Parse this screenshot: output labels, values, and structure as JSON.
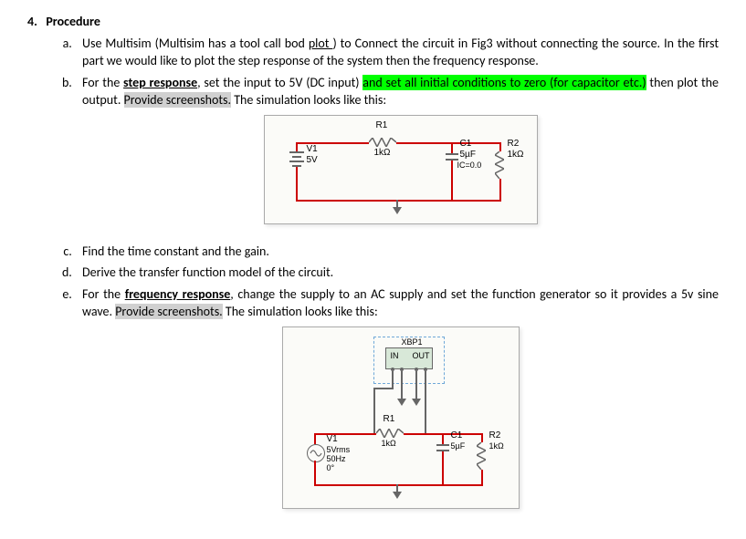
{
  "section": {
    "number": "4.",
    "title": "Procedure"
  },
  "items": {
    "a": {
      "t1": "Use Multisim (Multisim has a tool call bod ",
      "link": "plot ",
      "t2": ") to Connect the circuit in Fig3 without connecting the source. In the first part we would like to plot the step response of the system then the frequency response."
    },
    "b": {
      "t1": "For the ",
      "bu": "step response",
      "t2": ", set the input to 5V (DC input) ",
      "hl1": "and set all initial conditions to zero (for capacitor etc.)",
      "t3": " then plot the output. ",
      "hl2": "Provide screenshots.",
      "t4": " The simulation looks like this:"
    },
    "c": "Find the time constant and the gain.",
    "d": "Derive the transfer function model of the circuit.",
    "e": {
      "t1": "For the ",
      "bu": "frequency response",
      "t2": ", change the supply to an AC supply and set the function generator so it provides a 5v sine wave. ",
      "hl": "Provide screenshots.",
      "t3": " The simulation looks like this:"
    }
  },
  "ckt1": {
    "r1_name": "R1",
    "r1_val": "1kΩ",
    "v1_name": "V1",
    "v1_val": "5V",
    "c1_name": "C1",
    "c1_val": "5µF",
    "c1_ic": "IC=0.0",
    "r2_name": "R2",
    "r2_val": "1kΩ"
  },
  "ckt2": {
    "bode": "XBP1",
    "in": "IN",
    "out": "OUT",
    "r1_name": "R1",
    "r1_val": "1kΩ",
    "v1_name": "V1",
    "v1_l1": "5Vrms",
    "v1_l2": "50Hz",
    "v1_l3": "0°",
    "c1_name": "C1",
    "c1_val": "5µF",
    "r2_name": "R2",
    "r2_val": "1kΩ"
  }
}
